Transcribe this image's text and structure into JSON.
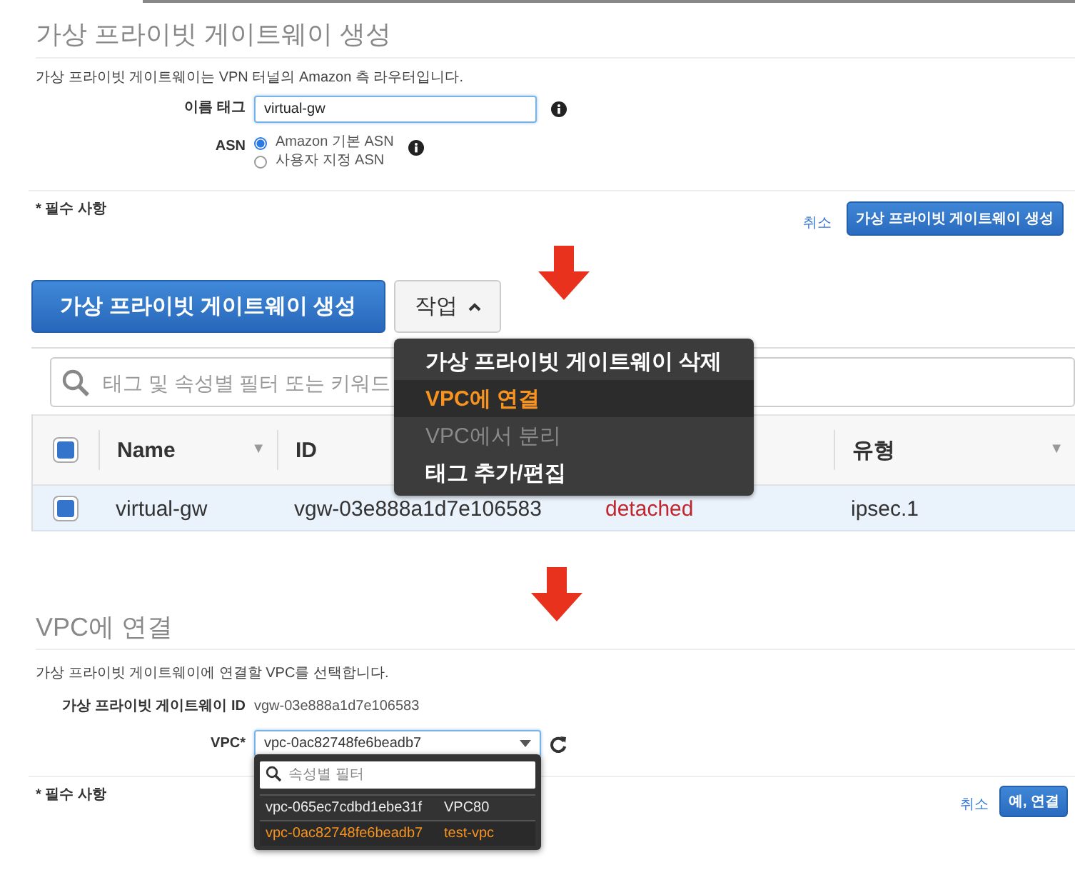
{
  "create_form": {
    "title": "가상 프라이빗 게이트웨이 생성",
    "description": "가상 프라이빗 게이트웨이는 VPN 터널의 Amazon 측 라우터입니다.",
    "fields": [
      {
        "kind": "text",
        "label": "이름 태그",
        "value": "virtual-gw"
      },
      {
        "kind": "radio",
        "label": "ASN",
        "options": [
          {
            "label": "Amazon 기본 ASN",
            "selected": true
          },
          {
            "label": "사용자 지정 ASN",
            "selected": false
          }
        ]
      }
    ],
    "required_note": "* 필수 사항",
    "cancel": "취소",
    "submit": "가상 프라이빗 게이트웨이 생성"
  },
  "gateway_list": {
    "create_button": "가상 프라이빗 게이트웨이 생성",
    "actions_button": "작업",
    "search_placeholder": "태그 및 속성별 필터 또는 키워드",
    "actions_menu": [
      {
        "label": "가상 프라이빗 게이트웨이 삭제",
        "selected": false,
        "disabled": false
      },
      {
        "label": "VPC에 연결",
        "selected": true,
        "disabled": false
      },
      {
        "label": "VPC에서 분리",
        "selected": false,
        "disabled": true
      },
      {
        "label": "태그 추가/편집",
        "selected": false,
        "disabled": false
      }
    ],
    "select_all": {
      "checked": true
    },
    "columns": [
      {
        "label": "Name",
        "sort_mark": "▼"
      },
      {
        "label": "ID"
      },
      null,
      {
        "label": "유형",
        "sort_mark": "▼"
      }
    ],
    "rows": [
      {
        "selected": true,
        "cells": [
          "virtual-gw",
          "vgw-03e888a1d7e106583",
          "detached",
          "ipsec.1"
        ]
      }
    ]
  },
  "attach_form": {
    "title": "VPC에 연결",
    "description": "가상 프라이빗 게이트웨이에 연결할 VPC를 선택합니다.",
    "gateway_id_label": "가상 프라이빗 게이트웨이 ID",
    "gateway_id": "vgw-03e888a1d7e106583",
    "vpc_label": "VPC*",
    "vpc_value": "vpc-0ac82748fe6beadb7",
    "filter_placeholder": "속성별 필터",
    "options": [
      {
        "id": "vpc-065ec7cdbd1ebe31f",
        "name": "VPC80",
        "selected": false
      },
      {
        "id": "vpc-0ac82748fe6beadb7",
        "name": "test-vpc",
        "selected": true
      }
    ],
    "required_note": "* 필수 사항",
    "cancel": "취소",
    "submit": "예, 연결"
  }
}
